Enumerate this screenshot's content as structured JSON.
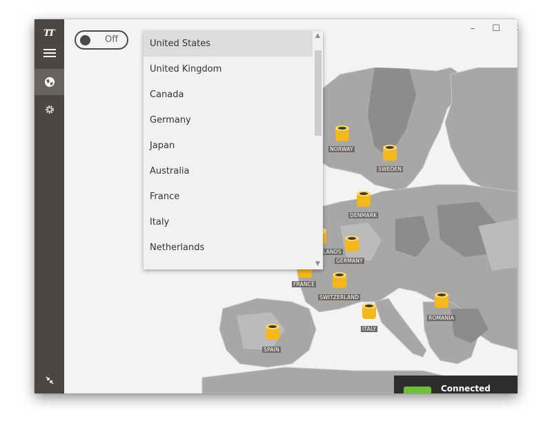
{
  "window": {
    "controls": {
      "minimize": "–",
      "maximize": "☐",
      "close": "✕"
    }
  },
  "sidebar": {
    "items": [
      {
        "name": "logo",
        "icon": "tunnelbear-logo-icon"
      },
      {
        "name": "menu",
        "icon": "hamburger-menu-icon"
      },
      {
        "name": "map",
        "icon": "globe-icon",
        "active": true
      },
      {
        "name": "settings",
        "icon": "gear-icon"
      },
      {
        "name": "collapse",
        "icon": "collapse-arrows-icon"
      }
    ]
  },
  "toggle": {
    "state_label": "Off"
  },
  "country_dropdown": {
    "selected": "United States",
    "options": [
      "United States",
      "United Kingdom",
      "Canada",
      "Germany",
      "Japan",
      "Australia",
      "France",
      "Italy",
      "Netherlands"
    ]
  },
  "map": {
    "countries": [
      "NORWAY",
      "SWEDEN",
      "DENMARK",
      "LANDS",
      "GERMANY",
      "FRANCE",
      "SWITZERLAND",
      "ROMANIA",
      "ITALY",
      "SPAIN"
    ]
  },
  "status": {
    "label": "Connected"
  },
  "colors": {
    "sidebar": "#4a4744",
    "sidebar_active": "#676360",
    "land": "#a9a7a5",
    "pin": "#f5b81c",
    "status_accent": "#6fbf3a"
  }
}
